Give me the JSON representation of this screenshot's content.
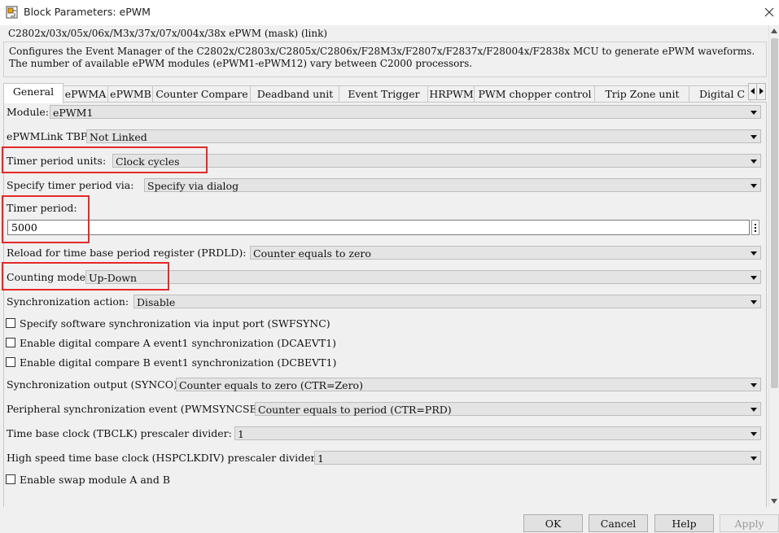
{
  "window": {
    "title": "Block Parameters: ePWM"
  },
  "mask": {
    "title": "C2802x/03x/05x/06x/M3x/37x/07x/004x/38x ePWM (mask) (link)",
    "description": [
      "Configures the Event Manager of the C2802x/C2803x/C2805x/C2806x/F28M3x/F2807x/F2837x/F28004x/F2838x MCU to generate ePWM waveforms.",
      "The number of available ePWM modules (ePWM1-ePWM12) vary between C2000 processors."
    ]
  },
  "tabs": [
    "General",
    "ePWMA",
    "ePWMB",
    "Counter Compare",
    "Deadband unit",
    "Event Trigger",
    "HRPWM",
    "PWM chopper control",
    "Trip Zone unit",
    "Digital C"
  ],
  "params": {
    "module": {
      "label": "Module:",
      "value": "ePWM1"
    },
    "link_tbprd": {
      "label": "ePWMLink TBPRD",
      "value": "Not Linked"
    },
    "timer_units": {
      "label": "Timer period units:",
      "value": "Clock cycles"
    },
    "specify_via": {
      "label": "Specify timer period via:",
      "value": "Specify via dialog"
    },
    "timer_period": {
      "label": "Timer period:",
      "value": "5000"
    },
    "prdld": {
      "label": "Reload for time base period register (PRDLD):",
      "value": "Counter equals to zero"
    },
    "counting_mode": {
      "label": "Counting mode:",
      "value": "Up-Down"
    },
    "sync_action": {
      "label": "Synchronization action:",
      "value": "Disable"
    },
    "cb_swfsync": {
      "label": "Specify software synchronization via input port (SWFSYNC)",
      "checked": false
    },
    "cb_dcaevt1": {
      "label": "Enable digital compare A event1 synchronization (DCAEVT1)",
      "checked": false
    },
    "cb_dcbevt1": {
      "label": "Enable digital compare B event1 synchronization (DCBEVT1)",
      "checked": false
    },
    "synco": {
      "label": "Synchronization output (SYNCO):",
      "value": "Counter equals to zero (CTR=Zero)"
    },
    "pwmsyncsel": {
      "label": "Peripheral synchronization event (PWMSYNCSEL):",
      "value": "Counter equals to period (CTR=PRD)"
    },
    "tbclk": {
      "label": "Time base clock (TBCLK) prescaler divider:",
      "value": "1"
    },
    "hspclkdiv": {
      "label": "High speed time base clock (HSPCLKDIV) prescaler divider:",
      "value": "1"
    },
    "cb_swap": {
      "label": "Enable swap module A and B",
      "checked": false
    }
  },
  "buttons": {
    "ok": "OK",
    "cancel": "Cancel",
    "help": "Help",
    "apply": "Apply"
  },
  "colors": {
    "highlight": "#e5292a"
  }
}
